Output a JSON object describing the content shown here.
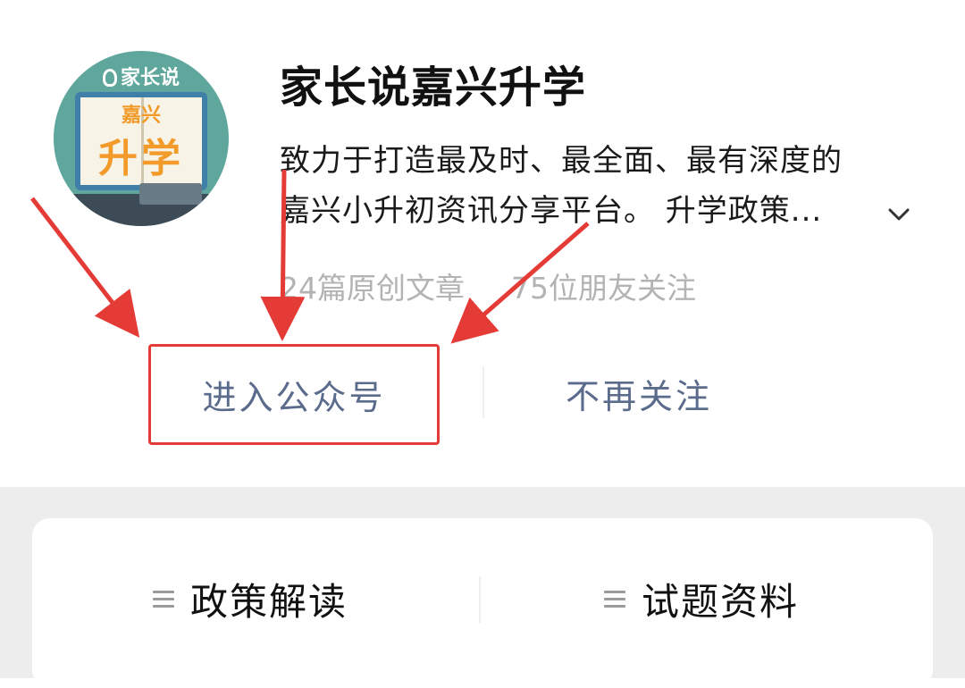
{
  "profile": {
    "avatar": {
      "brand": "家长说",
      "line1": "嘉兴",
      "line2": "升学"
    },
    "name": "家长说嘉兴升学",
    "description_line1": "致力于打造最及时、最全面、最有深度的",
    "description_line2": "嘉兴小升初资讯分享平台。 升学政策...",
    "expand_icon": "chevron-down-icon",
    "stats": {
      "articles": "24篇原创文章",
      "followers": "75位朋友关注"
    }
  },
  "actions": {
    "enter_label": "进入公众号",
    "unfollow_label": "不再关注"
  },
  "menu": {
    "items": [
      {
        "icon": "menu-lines-icon",
        "label": "政策解读"
      },
      {
        "icon": "menu-lines-icon",
        "label": "试题资料"
      }
    ]
  },
  "colors": {
    "link_text": "#5b6b8c",
    "annotation": "#e53b36",
    "stats_text": "#b3b3b3",
    "section_bg": "#ededed"
  }
}
